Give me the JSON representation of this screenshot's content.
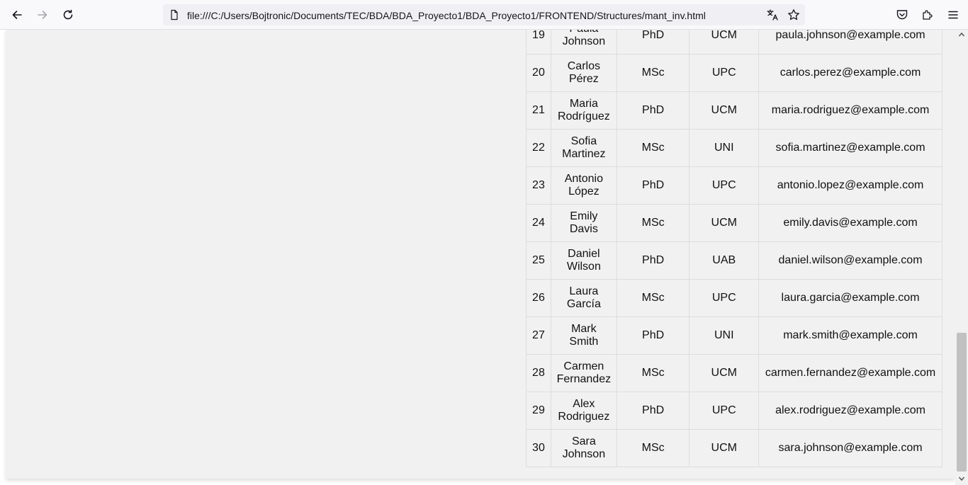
{
  "browser": {
    "url": "file:///C:/Users/Bojtronic/Documents/TEC/BDA/BDA_Proyecto1/BDA_Proyecto1/FRONTEND/Structures/mant_inv.html"
  },
  "icons": {
    "back": "arrow-left",
    "forward": "arrow-right",
    "reload": "reload",
    "page": "document",
    "translate": "translate",
    "bookmark": "star",
    "pocket": "pocket",
    "extensions": "puzzle",
    "menu": "hamburger"
  },
  "table": {
    "rows": [
      {
        "id": "19",
        "first": "Paula",
        "last": "Johnson",
        "degree": "PhD",
        "uni": "UCM",
        "email": "paula.johnson@example.com"
      },
      {
        "id": "20",
        "first": "Carlos",
        "last": "Pérez",
        "degree": "MSc",
        "uni": "UPC",
        "email": "carlos.perez@example.com"
      },
      {
        "id": "21",
        "first": "Maria",
        "last": "Rodríguez",
        "degree": "PhD",
        "uni": "UCM",
        "email": "maria.rodriguez@example.com"
      },
      {
        "id": "22",
        "first": "Sofia",
        "last": "Martinez",
        "degree": "MSc",
        "uni": "UNI",
        "email": "sofia.martinez@example.com"
      },
      {
        "id": "23",
        "first": "Antonio",
        "last": "López",
        "degree": "PhD",
        "uni": "UPC",
        "email": "antonio.lopez@example.com"
      },
      {
        "id": "24",
        "first": "Emily",
        "last": "Davis",
        "degree": "MSc",
        "uni": "UCM",
        "email": "emily.davis@example.com"
      },
      {
        "id": "25",
        "first": "Daniel",
        "last": "Wilson",
        "degree": "PhD",
        "uni": "UAB",
        "email": "daniel.wilson@example.com"
      },
      {
        "id": "26",
        "first": "Laura",
        "last": "García",
        "degree": "MSc",
        "uni": "UPC",
        "email": "laura.garcia@example.com"
      },
      {
        "id": "27",
        "first": "Mark",
        "last": "Smith",
        "degree": "PhD",
        "uni": "UNI",
        "email": "mark.smith@example.com"
      },
      {
        "id": "28",
        "first": "Carmen",
        "last": "Fernandez",
        "degree": "MSc",
        "uni": "UCM",
        "email": "carmen.fernandez@example.com"
      },
      {
        "id": "29",
        "first": "Alex",
        "last": "Rodriguez",
        "degree": "PhD",
        "uni": "UPC",
        "email": "alex.rodriguez@example.com"
      },
      {
        "id": "30",
        "first": "Sara",
        "last": "Johnson",
        "degree": "MSc",
        "uni": "UCM",
        "email": "sara.johnson@example.com"
      }
    ]
  }
}
